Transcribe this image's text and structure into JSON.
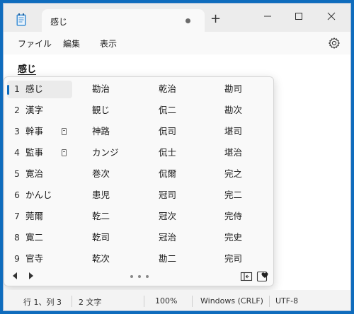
{
  "tab": {
    "title": "感じ"
  },
  "menu": {
    "file": "ファイル",
    "edit": "編集",
    "view": "表示"
  },
  "editor": {
    "text": "感じ"
  },
  "ime": {
    "rows": [
      {
        "num": "1",
        "cells": [
          "感じ",
          "勘治",
          "乾治",
          "勘司"
        ],
        "selected": true
      },
      {
        "num": "2",
        "cells": [
          "漢字",
          "観じ",
          "侃二",
          "勘次"
        ]
      },
      {
        "num": "3",
        "cells": [
          "幹事",
          "神路",
          "侃司",
          "堪司"
        ],
        "memo": true
      },
      {
        "num": "4",
        "cells": [
          "監事",
          "カンジ",
          "侃士",
          "堪治"
        ],
        "memo": true
      },
      {
        "num": "5",
        "cells": [
          "寛治",
          "巻次",
          "侃爾",
          "完之"
        ]
      },
      {
        "num": "6",
        "cells": [
          "かんじ",
          "患児",
          "冠司",
          "完二"
        ]
      },
      {
        "num": "7",
        "cells": [
          "莞爾",
          "乾二",
          "冠次",
          "完侍"
        ]
      },
      {
        "num": "8",
        "cells": [
          "寛二",
          "乾司",
          "冠治",
          "完史"
        ]
      },
      {
        "num": "9",
        "cells": [
          "官寺",
          "乾次",
          "勘二",
          "完司"
        ]
      }
    ]
  },
  "status": {
    "position": "行 1、列 3",
    "chars": "2 文字",
    "zoom": "100%",
    "eol": "Windows (CRLF)",
    "encoding": "UTF-8"
  },
  "colors": {
    "accent": "#0f6cbd",
    "desktop": "#0f6cbd"
  },
  "icons": [
    "notepad-icon",
    "settings-gear-icon",
    "minimize-icon",
    "maximize-icon",
    "close-icon",
    "memo-icon",
    "prev-arrow-icon",
    "next-arrow-icon",
    "table-view-icon",
    "favorite-icon"
  ]
}
